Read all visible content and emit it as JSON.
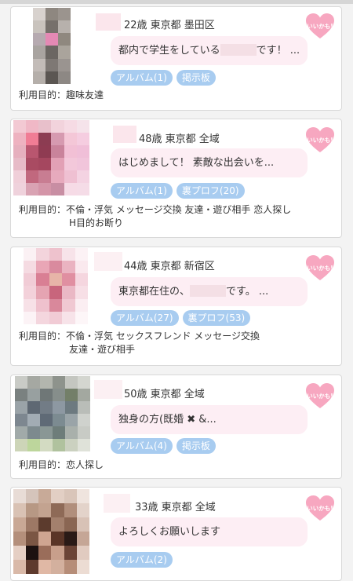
{
  "like_label": "いいかも!",
  "colors": {
    "tag_bg": "#a8ccf0",
    "bubble_bg": "#fdeef4",
    "heart": "#f7a7c0"
  },
  "profiles": [
    {
      "meta": "22歳 東京都 墨田区",
      "message_a": "都内で学生をしている",
      "message_b": "です！ ...",
      "tags": [
        "アルバム(1)",
        "掲示板"
      ],
      "purpose_line1": "利用目的：趣味友達",
      "purpose_line2": ""
    },
    {
      "meta": "48歳 東京都 全域",
      "message_a": "はじめまして！ 素敵な出会いを...",
      "message_b": "",
      "tags": [
        "アルバム(1)",
        "裏プロフ(20)"
      ],
      "purpose_line1": "利用目的：不倫・浮気 メッセージ交換 友達・遊び相手 恋人探し",
      "purpose_line2": "H目的お断り"
    },
    {
      "meta": "44歳 東京都 新宿区",
      "message_a": "東京都在住の、",
      "message_b": "です。 ...",
      "tags": [
        "アルバム(27)",
        "裏プロフ(53)"
      ],
      "purpose_line1": "利用目的：不倫・浮気 セックスフレンド メッセージ交換",
      "purpose_line2": "友達・遊び相手"
    },
    {
      "meta": "50歳 東京都 全域",
      "message_a": "独身の方(既婚 ✖ &...",
      "message_b": "",
      "tags": [
        "アルバム(4)",
        "掲示板"
      ],
      "purpose_line1": "利用目的：恋人探し",
      "purpose_line2": ""
    },
    {
      "meta": "33歳 東京都 全域",
      "message_a": "よろしくお願いします",
      "message_b": "",
      "tags": [
        "アルバム(2)"
      ],
      "purpose_line1": "",
      "purpose_line2": ""
    }
  ]
}
